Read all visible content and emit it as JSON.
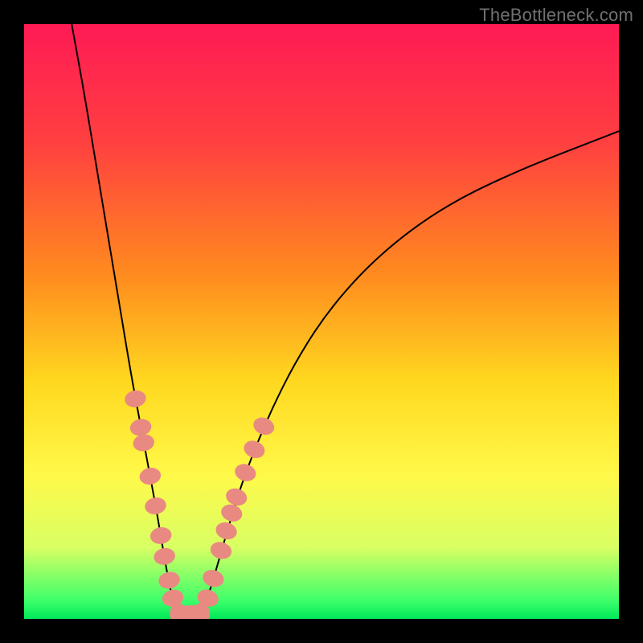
{
  "watermark": "TheBottleneck.com",
  "chart_data": {
    "type": "line",
    "title": "",
    "xlabel": "",
    "ylabel": "",
    "xlim": [
      0,
      100
    ],
    "ylim": [
      0,
      100
    ],
    "grid": false,
    "background_gradient_stops": [
      {
        "offset": 0.0,
        "color": "#ff1a55"
      },
      {
        "offset": 0.2,
        "color": "#ff4040"
      },
      {
        "offset": 0.42,
        "color": "#ff8a1f"
      },
      {
        "offset": 0.6,
        "color": "#ffd81f"
      },
      {
        "offset": 0.76,
        "color": "#fff94a"
      },
      {
        "offset": 0.88,
        "color": "#d8ff63"
      },
      {
        "offset": 0.97,
        "color": "#3cff6a"
      },
      {
        "offset": 1.0,
        "color": "#00e85a"
      }
    ],
    "series": [
      {
        "name": "left-branch",
        "x": [
          8.0,
          10.0,
          12.0,
          14.0,
          16.0,
          18.0,
          19.5,
          21.0,
          22.3,
          23.3,
          24.0,
          24.7,
          25.3,
          25.7
        ],
        "y": [
          100.0,
          89.0,
          77.0,
          65.0,
          53.0,
          41.0,
          33.0,
          25.0,
          18.0,
          12.0,
          8.0,
          4.5,
          2.0,
          0.8
        ]
      },
      {
        "name": "valley-floor",
        "x": [
          25.7,
          27.0,
          28.5,
          30.0
        ],
        "y": [
          0.8,
          0.3,
          0.3,
          0.8
        ]
      },
      {
        "name": "right-branch",
        "x": [
          30.0,
          31.0,
          32.5,
          34.5,
          37.0,
          41.0,
          46.0,
          52.0,
          60.0,
          70.0,
          82.0,
          100.0
        ],
        "y": [
          0.8,
          4.0,
          9.0,
          16.0,
          24.0,
          34.0,
          44.0,
          53.0,
          61.5,
          69.0,
          75.0,
          82.0
        ]
      }
    ],
    "bead_groups": [
      {
        "name": "left-cluster",
        "points": [
          {
            "x": 18.7,
            "y": 37.0
          },
          {
            "x": 19.6,
            "y": 32.2
          },
          {
            "x": 20.1,
            "y": 29.6
          },
          {
            "x": 21.2,
            "y": 24.0
          },
          {
            "x": 22.1,
            "y": 19.0
          },
          {
            "x": 23.0,
            "y": 14.0
          },
          {
            "x": 23.6,
            "y": 10.5
          },
          {
            "x": 24.4,
            "y": 6.5
          },
          {
            "x": 25.0,
            "y": 3.5
          }
        ]
      },
      {
        "name": "floor-cluster",
        "points": [
          {
            "x": 25.9,
            "y": 0.9
          },
          {
            "x": 26.9,
            "y": 0.5
          },
          {
            "x": 27.9,
            "y": 0.5
          },
          {
            "x": 28.9,
            "y": 0.6
          },
          {
            "x": 29.8,
            "y": 0.9
          }
        ]
      },
      {
        "name": "right-cluster",
        "points": [
          {
            "x": 30.9,
            "y": 3.5
          },
          {
            "x": 31.8,
            "y": 6.8
          },
          {
            "x": 33.1,
            "y": 11.5
          },
          {
            "x": 34.0,
            "y": 14.8
          },
          {
            "x": 34.9,
            "y": 17.8
          },
          {
            "x": 35.7,
            "y": 20.5
          },
          {
            "x": 37.2,
            "y": 24.6
          },
          {
            "x": 38.7,
            "y": 28.5
          },
          {
            "x": 40.3,
            "y": 32.4
          }
        ]
      }
    ],
    "bead_style": {
      "fill": "#e98a82",
      "rx": 1.4,
      "ry": 1.8
    },
    "curve_stroke": "#000000",
    "curve_stroke_width": 2.0
  }
}
